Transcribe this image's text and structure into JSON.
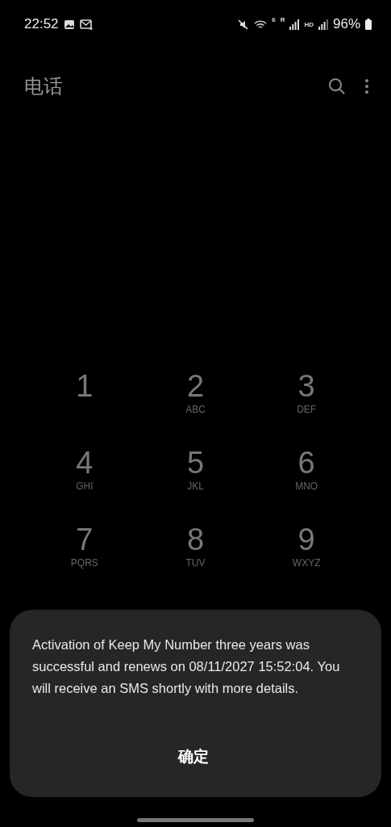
{
  "status_bar": {
    "time": "22:52",
    "wifi_label": "6",
    "signal_label": "R",
    "hd_label": "HD",
    "battery": "96%"
  },
  "app_bar": {
    "title": "电话"
  },
  "keypad": [
    {
      "digit": "1"
    },
    {
      "digit": "2",
      "letters": "ABC"
    },
    {
      "digit": "3",
      "letters": "DEF"
    },
    {
      "digit": "4",
      "letters": "GHI"
    },
    {
      "digit": "5",
      "letters": "JKL"
    },
    {
      "digit": "6",
      "letters": "MNO"
    },
    {
      "digit": "7",
      "letters": "PQRS"
    },
    {
      "digit": "8",
      "letters": "TUV"
    },
    {
      "digit": "9",
      "letters": "WXYZ"
    }
  ],
  "dialog": {
    "message": "Activation of Keep My Number three years was successful and renews on 08/11/2027 15:52:04. You will receive an SMS shortly with more details.",
    "button": "确定"
  }
}
